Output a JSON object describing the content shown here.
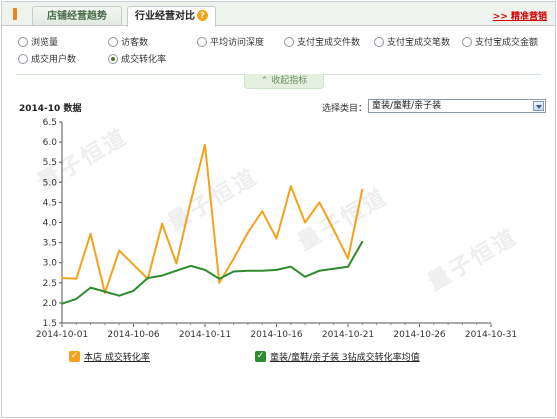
{
  "tabs": [
    {
      "label": "店铺经营趋势",
      "active": false
    },
    {
      "label": "行业经营对比",
      "active": true
    }
  ],
  "help_icon_glyph": "?",
  "top_link": ">> 精准营销",
  "metrics": [
    {
      "label": "浏览量",
      "selected": false
    },
    {
      "label": "访客数",
      "selected": false
    },
    {
      "label": "平均访问深度",
      "selected": false
    },
    {
      "label": "支付宝成交件数",
      "selected": false
    },
    {
      "label": "支付宝成交笔数",
      "selected": false
    },
    {
      "label": "支付宝成交金额",
      "selected": false
    },
    {
      "label": "成交用户数",
      "selected": false
    },
    {
      "label": "成交转化率",
      "selected": true
    }
  ],
  "collapse": {
    "label": "收起指标",
    "icon": "chevron-up-icon"
  },
  "section_title": "2014-10 数据",
  "category": {
    "label": "选择类目：",
    "value": "童装/童鞋/亲子装"
  },
  "legend": [
    {
      "label": "本店 成交转化率",
      "color": "#f4a21c",
      "checked": true
    },
    {
      "label": "童装/童鞋/亲子装 3钻成交转化率均值",
      "color": "#2e8b2e",
      "checked": true
    }
  ],
  "watermark": "量子恒道",
  "colors": {
    "accent_red": "#d00000",
    "tab_marker": "#f0821e",
    "store_line": "#f4a21c",
    "industry_line": "#2e8b2e"
  },
  "chart_data": {
    "type": "line",
    "ylim": [
      1.5,
      6.5
    ],
    "y_ticks": [
      "1.5",
      "2.0",
      "2.5",
      "3.0",
      "3.5",
      "4.0",
      "4.5",
      "5.0",
      "5.5",
      "6.0",
      "6.5"
    ],
    "x_ticks": [
      "2014-10-01",
      "2014-10-06",
      "2014-10-11",
      "2014-10-16",
      "2014-10-21",
      "2014-10-26",
      "2014-10-31"
    ],
    "x_range": [
      "2014-10-01",
      "2014-10-31"
    ],
    "series": [
      {
        "name": "本店 成交转化率",
        "color": "#f4a21c",
        "x": [
          "2014-10-01",
          "2014-10-02",
          "2014-10-03",
          "2014-10-04",
          "2014-10-05",
          "2014-10-06",
          "2014-10-07",
          "2014-10-08",
          "2014-10-09",
          "2014-10-10",
          "2014-10-11",
          "2014-10-12",
          "2014-10-13",
          "2014-10-14",
          "2014-10-15",
          "2014-10-16",
          "2014-10-17",
          "2014-10-18",
          "2014-10-19",
          "2014-10-20",
          "2014-10-21",
          "2014-10-22"
        ],
        "values": [
          2.62,
          2.6,
          3.72,
          2.25,
          3.3,
          2.95,
          2.6,
          3.97,
          2.98,
          4.52,
          5.93,
          2.5,
          3.1,
          3.75,
          4.28,
          3.6,
          4.9,
          4.0,
          4.5,
          3.82,
          3.1,
          4.82
        ]
      },
      {
        "name": "童装/童鞋/亲子装 3钻成交转化率均值",
        "color": "#2e8b2e",
        "x": [
          "2014-10-01",
          "2014-10-02",
          "2014-10-03",
          "2014-10-04",
          "2014-10-05",
          "2014-10-06",
          "2014-10-07",
          "2014-10-08",
          "2014-10-09",
          "2014-10-10",
          "2014-10-11",
          "2014-10-12",
          "2014-10-13",
          "2014-10-14",
          "2014-10-15",
          "2014-10-16",
          "2014-10-17",
          "2014-10-18",
          "2014-10-19",
          "2014-10-20",
          "2014-10-21",
          "2014-10-22"
        ],
        "values": [
          1.98,
          2.1,
          2.38,
          2.28,
          2.18,
          2.3,
          2.62,
          2.68,
          2.8,
          2.92,
          2.82,
          2.6,
          2.78,
          2.8,
          2.8,
          2.82,
          2.9,
          2.65,
          2.8,
          2.85,
          2.9,
          3.52
        ]
      }
    ],
    "grid": false,
    "legend_position": "bottom"
  }
}
